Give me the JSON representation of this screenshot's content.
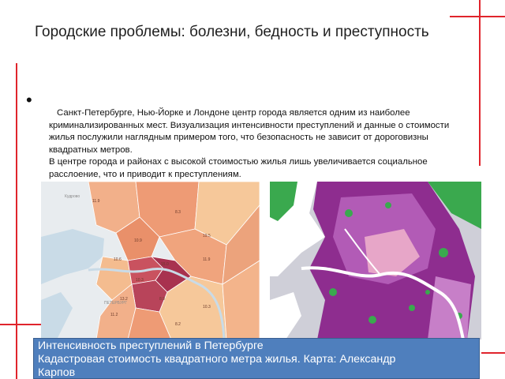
{
  "slide": {
    "title": "Городские проблемы: болезни, бедность и преступность",
    "bullet": "•",
    "paragraph1": "Санкт-Петербурге, Нью-Йорке и Лондоне центр города является одним из наиболее криминализированных мест. Визуализация интенсивности преступлений и данные о стоимости жилья послужили наглядным примером того, что безопасность не зависит от дороговизны квадратных метров.",
    "paragraph2": "В центре города и районах с высокой стоимостью жилья лишь увеличивается социальное расслоение, что и приводит к преступлениям.",
    "caption": {
      "line1": "Интенсивность преступлений в Петербурге",
      "line2": "Кадастровая стоимость квадратного метра жилья. Карта: Александр",
      "line3": "Карпов"
    }
  },
  "map_left": {
    "district_values": [
      "11.9",
      "8.3",
      "10.9",
      "19.5",
      "10.6",
      "11.9",
      "15.0",
      "10.3",
      "8.9",
      "13.2",
      "10.3",
      "8.2",
      "11.2"
    ],
    "place_labels": [
      "Кудрово",
      "ПЕТЕРБУРГ"
    ],
    "colors": {
      "low": "#f6c89a",
      "mid": "#e9906a",
      "high": "#c9525f",
      "top": "#a8324f"
    }
  },
  "map_right": {
    "colors": {
      "purple": "#8e2d8f",
      "violet": "#b25bb6",
      "green": "#3aa94e",
      "pink": "#e7a6c8",
      "water": "#ffffff"
    }
  },
  "decor": {
    "accent": "#e0242c"
  }
}
